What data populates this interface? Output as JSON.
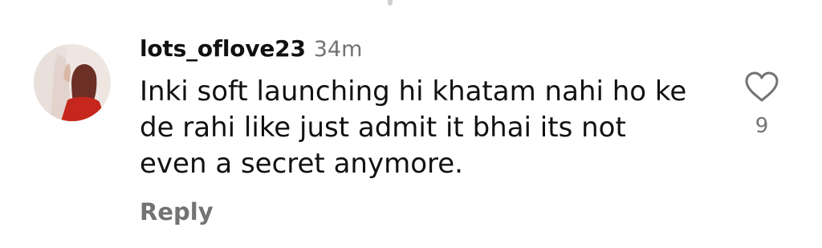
{
  "comment": {
    "username": "lots_oflove23",
    "timestamp": "34m",
    "text": "Inki soft launching hi khatam nahi ho ke de rahi like just admit it bhai its not even a secret anymore.",
    "reply_label": "Reply",
    "like_count": "9",
    "like_icon": "heart-outline-icon"
  },
  "colors": {
    "text_primary": "#111111",
    "text_secondary": "#737373",
    "background": "#ffffff"
  }
}
